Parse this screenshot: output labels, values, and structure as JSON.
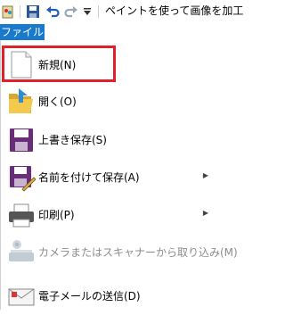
{
  "window": {
    "title": "ペイントを使って画像を加工"
  },
  "ribbon": {
    "file_tab": "ファイル"
  },
  "menu": {
    "items": [
      {
        "label": "新規(N)",
        "icon": "new-document-icon",
        "has_submenu": false,
        "enabled": true
      },
      {
        "label": "開く(O)",
        "icon": "open-folder-icon",
        "has_submenu": false,
        "enabled": true
      },
      {
        "label": "上書き保存(S)",
        "icon": "save-icon",
        "has_submenu": false,
        "enabled": true
      },
      {
        "label": "名前を付けて保存(A)",
        "icon": "save-as-icon",
        "has_submenu": true,
        "enabled": true
      },
      {
        "label": "印刷(P)",
        "icon": "printer-icon",
        "has_submenu": true,
        "enabled": true
      },
      {
        "label": "カメラまたはスキャナーから取り込み(M)",
        "icon": "scanner-icon",
        "has_submenu": false,
        "enabled": false
      },
      {
        "label": "電子メールの送信(D)",
        "icon": "email-icon",
        "has_submenu": false,
        "enabled": true
      }
    ]
  },
  "colors": {
    "file_tab": "#1979ca",
    "highlight": "#e0202a"
  }
}
